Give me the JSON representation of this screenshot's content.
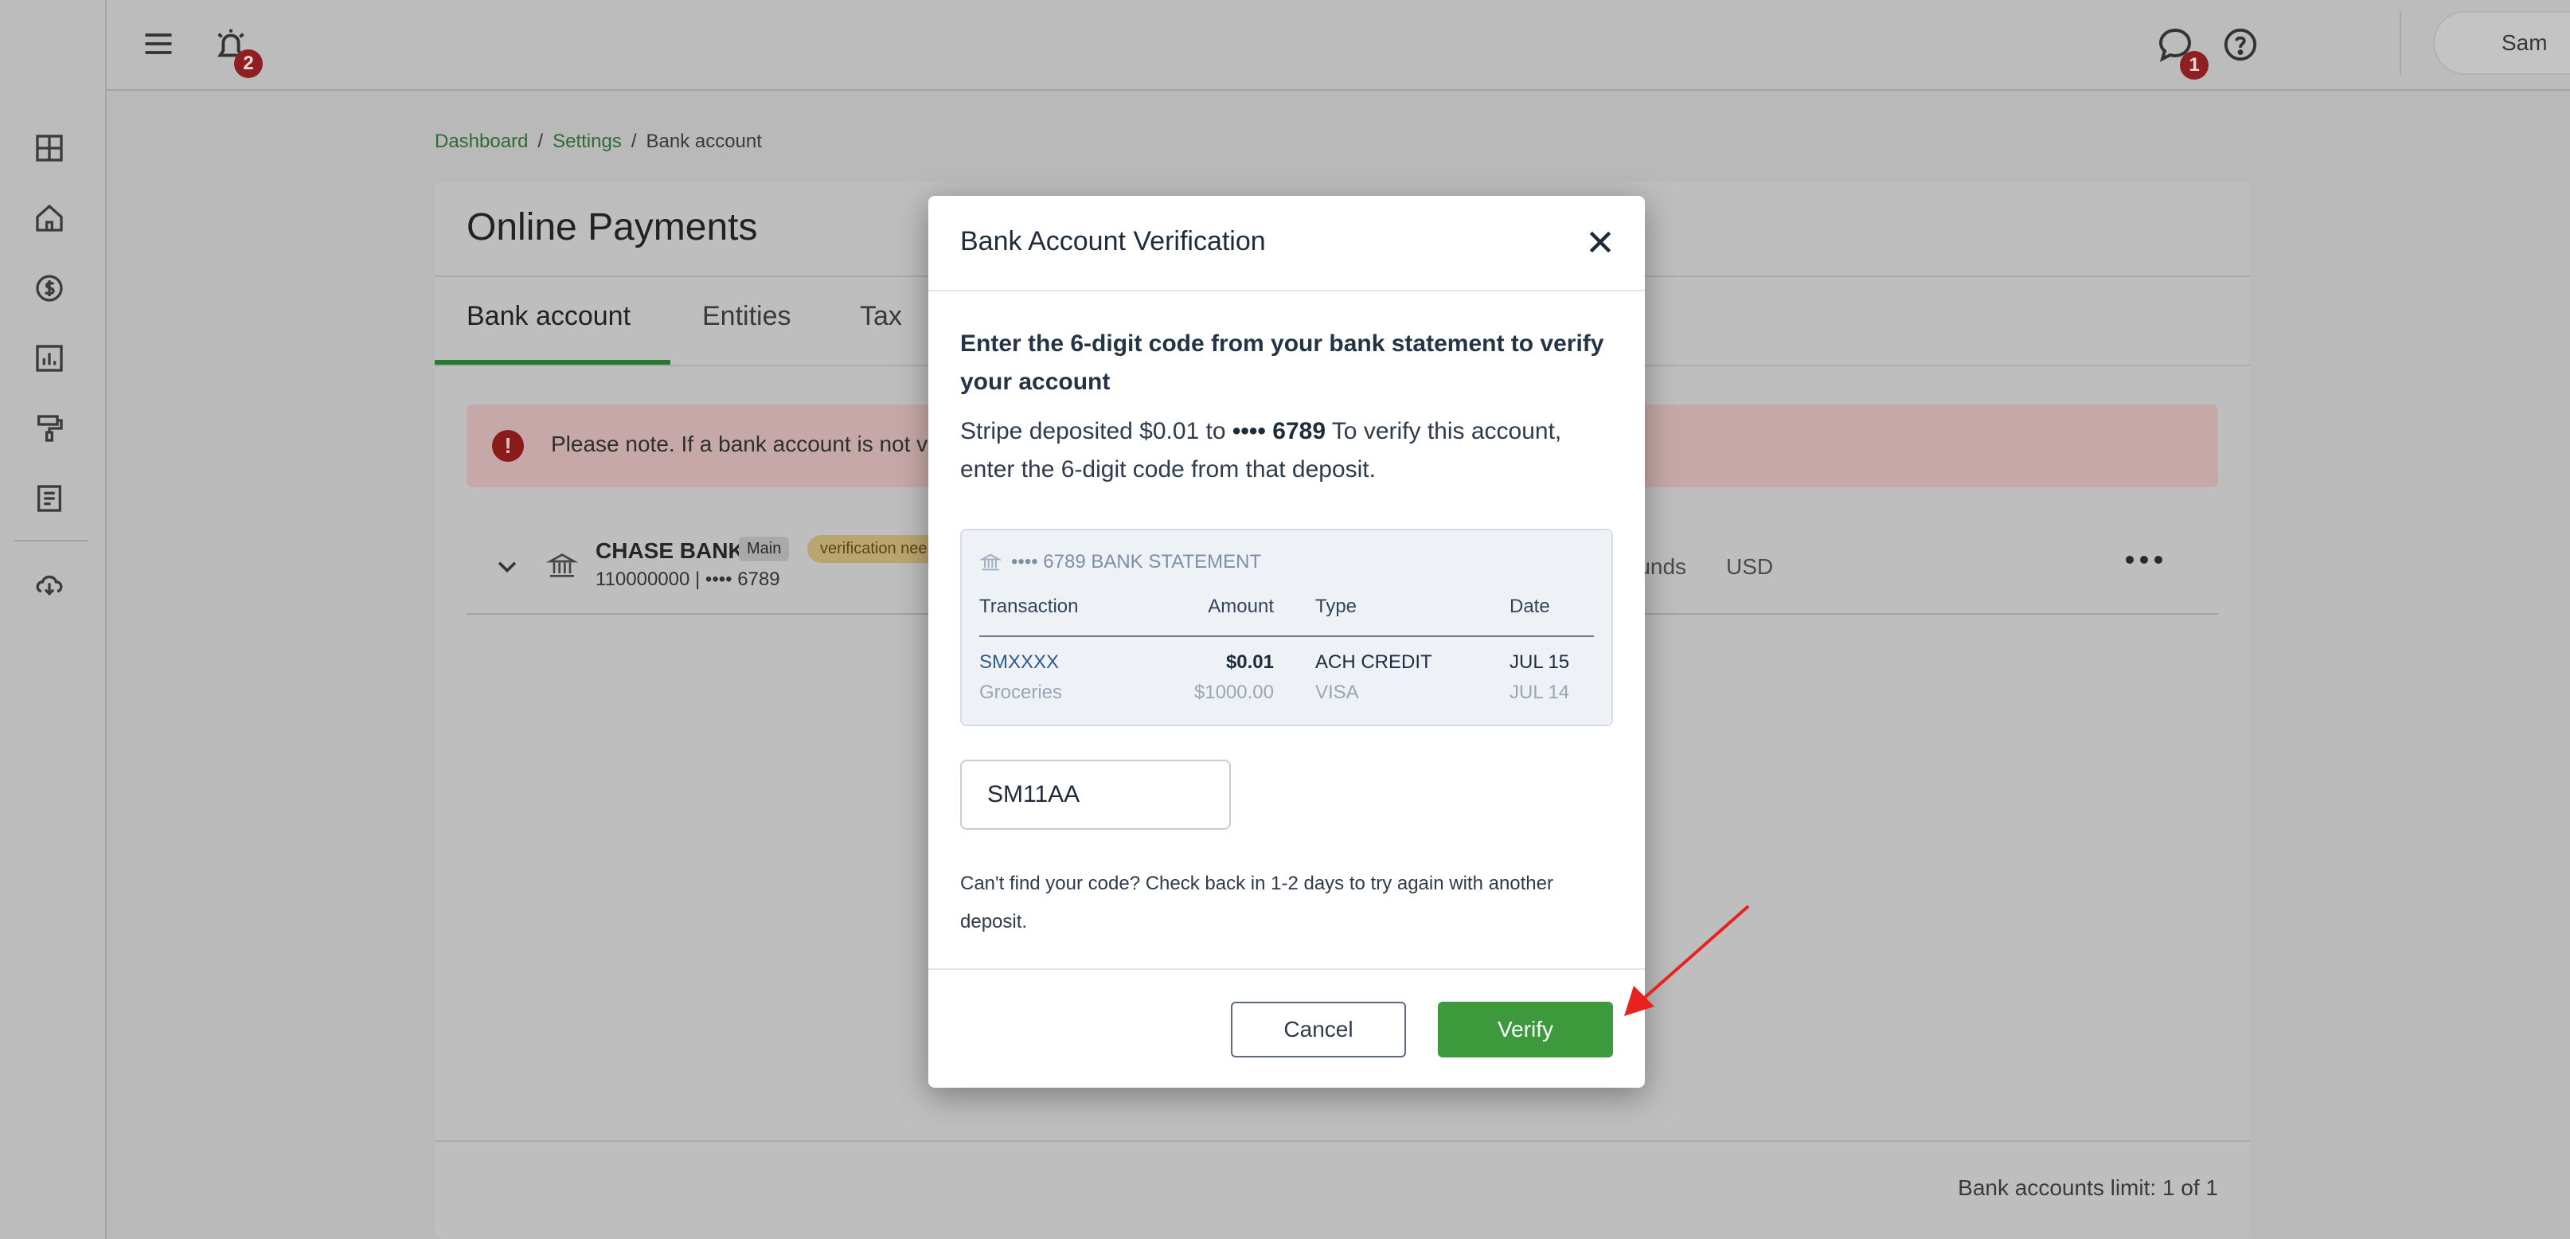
{
  "topbar": {
    "notification_badge": "2",
    "chat_badge": "1",
    "user_name": "Sam"
  },
  "breadcrumb": {
    "items": [
      "Dashboard",
      "Settings",
      "Bank account"
    ],
    "separator": "/"
  },
  "page": {
    "title": "Online Payments",
    "tabs": [
      {
        "label": "Bank account",
        "active": true
      },
      {
        "label": "Entities",
        "active": false
      },
      {
        "label": "Tax",
        "active": false
      }
    ],
    "alert_text": "Please note. If a bank account is not ve",
    "bank": {
      "name": "CHASE BANK",
      "main_tag": "Main",
      "status_tag": "verification nee",
      "details": "110000000 | •••• 6789",
      "funds_label": "t funds",
      "currency": "USD"
    },
    "limit_text": "Bank accounts limit: 1 of 1"
  },
  "modal": {
    "title": "Bank Account Verification",
    "instruction_bold": "Enter the 6-digit code from your bank statement to verify your account",
    "instruction_pre": "Stripe deposited $0.01 to ",
    "instruction_acct": "•••• 6789",
    "instruction_post": " To verify this account, enter the 6-digit code from that deposit.",
    "statement": {
      "header": "•••• 6789 BANK STATEMENT",
      "columns": [
        "Transaction",
        "Amount",
        "Type",
        "Date"
      ],
      "rows": [
        {
          "transaction": "SMXXXX",
          "amount": "$0.01",
          "type": "ACH CREDIT",
          "date": "JUL 15"
        },
        {
          "transaction": "Groceries",
          "amount": "$1000.00",
          "type": "VISA",
          "date": "JUL 14"
        }
      ]
    },
    "code_value": "SM11AA",
    "help_text": "Can't find your code? Check back in 1-2 days to try again with another deposit.",
    "cancel_label": "Cancel",
    "verify_label": "Verify"
  },
  "colors": {
    "accent_green": "#3c9a3d",
    "annotation_arrow": "#e8231f"
  }
}
